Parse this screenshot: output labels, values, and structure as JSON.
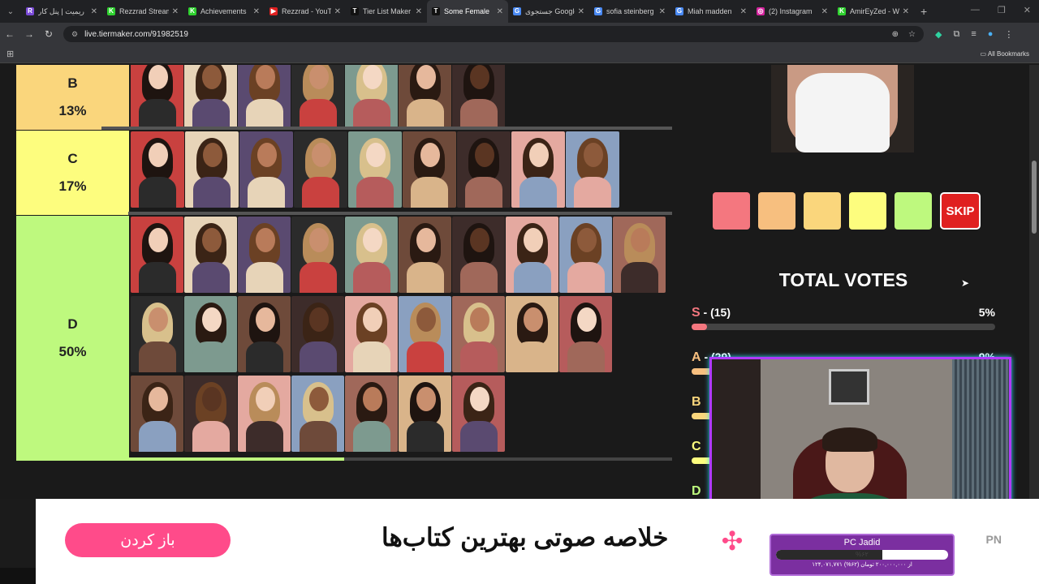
{
  "tabs": [
    {
      "label": "ریمیت | پنل کار",
      "fav_color": "#7b4bd8",
      "fav": "R",
      "active": false
    },
    {
      "label": "Rezzrad Stream",
      "fav_color": "#2fd22f",
      "fav": "K",
      "active": false
    },
    {
      "label": "Achievements",
      "fav_color": "#2fd22f",
      "fav": "K",
      "active": false
    },
    {
      "label": "Rezzrad - YouT",
      "fav_color": "#e02020",
      "fav": "▶",
      "active": false
    },
    {
      "label": "Tier List Maker",
      "fav_color": "#111111",
      "fav": "T",
      "active": false
    },
    {
      "label": "Some Female",
      "fav_color": "#111111",
      "fav": "T",
      "active": true
    },
    {
      "label": "جستجوی Google",
      "fav_color": "#4a8af4",
      "fav": "G",
      "active": false
    },
    {
      "label": "sofia steinberg",
      "fav_color": "#4a8af4",
      "fav": "G",
      "active": false
    },
    {
      "label": "Miah madden",
      "fav_color": "#4a8af4",
      "fav": "G",
      "active": false
    },
    {
      "label": "(2) Instagram",
      "fav_color": "#d6249f",
      "fav": "◎",
      "active": false
    },
    {
      "label": "AmirEyZed - W",
      "fav_color": "#2fd22f",
      "fav": "K",
      "active": false
    }
  ],
  "address": {
    "url": "live.tiermaker.com/91982519"
  },
  "bookmarks": {
    "all_label": "All Bookmarks"
  },
  "tiers": [
    {
      "key": "B",
      "percent": "13%",
      "color": "#fad67c"
    },
    {
      "key": "C",
      "percent": "17%",
      "color": "#fdfd7e"
    },
    {
      "key": "D",
      "percent": "50%",
      "color": "#bef97e"
    }
  ],
  "vote_buttons": [
    {
      "tier": "S",
      "color": "#f4777f"
    },
    {
      "tier": "A",
      "color": "#f7bf7f"
    },
    {
      "tier": "B",
      "color": "#fad67c"
    },
    {
      "tier": "C",
      "color": "#fdfd7e"
    },
    {
      "tier": "D",
      "color": "#bef97e"
    }
  ],
  "skip_label": "SKIP",
  "totals": {
    "title": "TOTAL VOTES",
    "rows": [
      {
        "tier": "S",
        "label": " - (15)",
        "percent": "5%",
        "fraction": 0.05,
        "color": "#f4777f"
      },
      {
        "tier": "A",
        "label": " - (29)",
        "percent": "9%",
        "fraction": 0.09,
        "color": "#f7bf7f"
      },
      {
        "tier": "B",
        "label": "",
        "percent": "",
        "fraction": 0.13,
        "color": "#fad67c"
      },
      {
        "tier": "C",
        "label": "",
        "percent": "",
        "fraction": 0.17,
        "color": "#fdfd7e"
      },
      {
        "tier": "D",
        "label": "",
        "percent": "",
        "fraction": 0.5,
        "color": "#bef97e"
      }
    ]
  },
  "ad": {
    "button_label": "باز کردن",
    "headline": "خلاصه صوتی بهترین کتاب‌ها",
    "pn_label": "PN"
  },
  "donation": {
    "name": "PC Jadid",
    "percent": "%۶۲",
    "progress": 0.62,
    "subtitle": "۱۲۴,۰۷۱,۷۷۱ از ۲۰۰,۰۰۰,۰۰۰ تومان (۶۲%)"
  }
}
